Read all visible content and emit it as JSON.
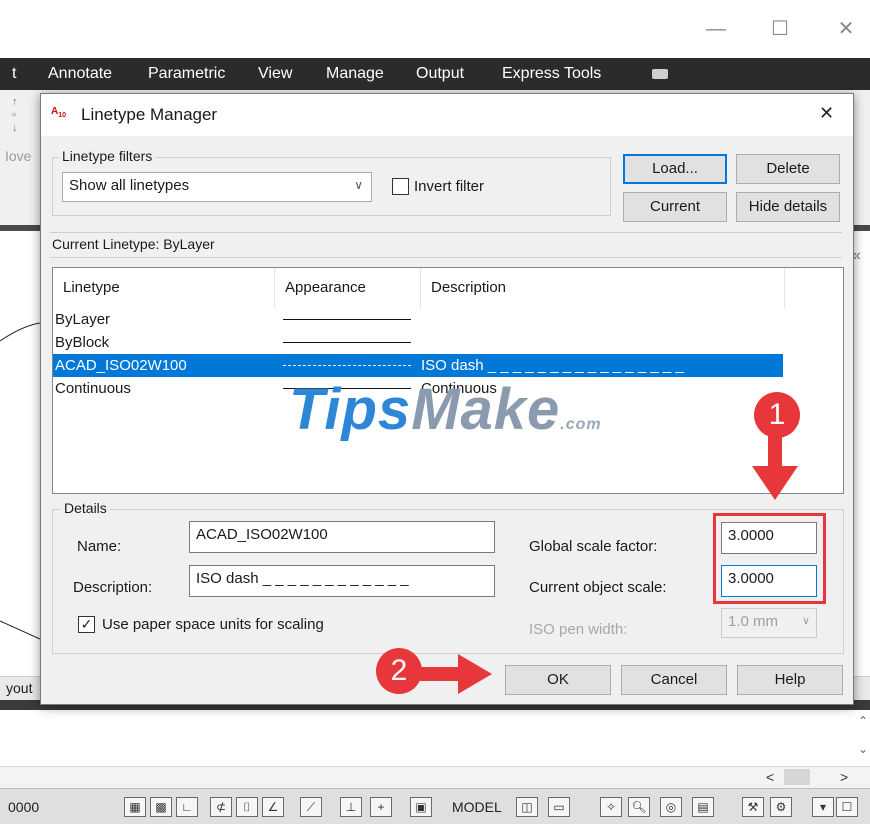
{
  "ribbon_tabs": [
    "t",
    "Annotate",
    "Parametric",
    "View",
    "Manage",
    "Output",
    "Express Tools"
  ],
  "window_buttons": {
    "minimize": "—",
    "maximize": "☐",
    "close": "✕"
  },
  "ribbon_partial_label": "Iove",
  "layout_tab_partial": "yout",
  "dialog": {
    "title": "Linetype Manager",
    "close_glyph": "✕",
    "filters_label": "Linetype filters",
    "filter_value": "Show all linetypes",
    "invert_filter_label": "Invert filter",
    "buttons": {
      "load": "Load...",
      "delete": "Delete",
      "current": "Current",
      "hide_details": "Hide details"
    },
    "current_linetype": "Current Linetype:  ByLayer",
    "columns": [
      "Linetype",
      "Appearance",
      "Description"
    ],
    "rows": [
      {
        "name": "ByLayer",
        "appearance": "solid",
        "description": ""
      },
      {
        "name": "ByBlock",
        "appearance": "solid",
        "description": ""
      },
      {
        "name": "ACAD_ISO02W100",
        "appearance": "dash",
        "description": "ISO dash _ _ _ _ _ _ _ _ _ _ _ _ _ _ _ _",
        "selected": true
      },
      {
        "name": "Continuous",
        "appearance": "solid",
        "description": "Continuous"
      }
    ],
    "details": {
      "label": "Details",
      "name_label": "Name:",
      "name_value": "ACAD_ISO02W100",
      "description_label": "Description:",
      "description_value": "ISO dash _ _ _ _ _ _ _ _ _ _ _ _",
      "paper_space_label": "Use paper space units for scaling",
      "paper_space_checked": true,
      "global_scale_label": "Global scale factor:",
      "global_scale_value": "3.0000",
      "object_scale_label": "Current object scale:",
      "object_scale_value": "3.0000",
      "pen_width_label": "ISO pen width:",
      "pen_width_value": "1.0 mm"
    },
    "footer_buttons": {
      "ok": "OK",
      "cancel": "Cancel",
      "help": "Help"
    }
  },
  "annotations": {
    "step1": "1",
    "step2": "2",
    "highlight_color": "#e8373a"
  },
  "watermark": {
    "main": "TipsMake",
    "suffix": ".com"
  },
  "statusbar": {
    "coords": "0000",
    "model": "MODEL"
  },
  "hscroll": {
    "left": "<",
    "right": ">"
  }
}
